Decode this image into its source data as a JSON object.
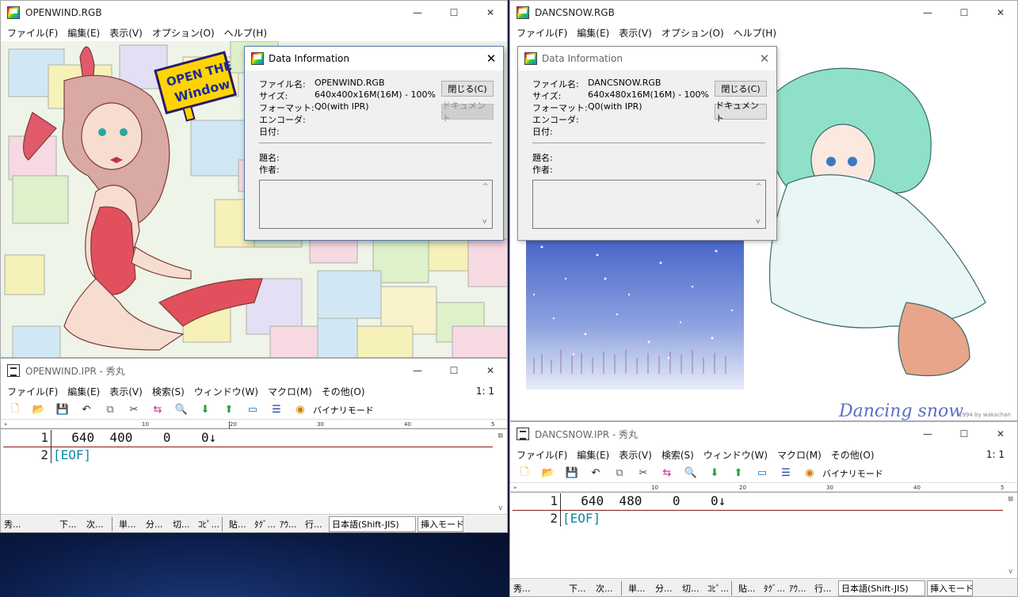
{
  "window_left": {
    "title": "OPENWIND.RGB",
    "menu": [
      "ファイル(F)",
      "編集(E)",
      "表示(V)",
      "オプション(O)",
      "ヘルプ(H)"
    ],
    "image_logo_lines": [
      "OPEN THE",
      "Window"
    ]
  },
  "window_right": {
    "title": "DANCSNOW.RGB",
    "menu": [
      "ファイル(F)",
      "編集(E)",
      "表示(V)",
      "オプション(O)",
      "ヘルプ(H)"
    ],
    "image_caption": "Dancing snow",
    "image_credit": "1994 by wakachan"
  },
  "dialog_left": {
    "title": "Data Information",
    "labels": {
      "filename": "ファイル名:",
      "size": "サイズ:",
      "format": "フォーマット:",
      "encoder": "エンコーダ:",
      "date": "日付:",
      "heading": "題名:",
      "author": "作者:"
    },
    "values": {
      "filename": "OPENWIND.RGB",
      "size": "640x400x16M(16M) - 100%",
      "format": "Q0(with IPR)"
    },
    "close_button": "閉じる(C)",
    "document_button": "ドキュメント"
  },
  "dialog_right": {
    "title": "Data Information",
    "labels": {
      "filename": "ファイル名:",
      "size": "サイズ:",
      "format": "フォーマット:",
      "encoder": "エンコーダ:",
      "date": "日付:",
      "heading": "題名:",
      "author": "作者:"
    },
    "values": {
      "filename": "DANCSNOW.RGB",
      "size": "640x480x16M(16M) - 100%",
      "format": "Q0(with IPR)"
    },
    "close_button": "閉じる(C)",
    "document_button": "ドキュメント"
  },
  "editor_left": {
    "title": "OPENWIND.IPR - 秀丸",
    "menu": [
      "ファイル(F)",
      "編集(E)",
      "表示(V)",
      "検索(S)",
      "ウィンドウ(W)",
      "マクロ(M)",
      "その他(O)"
    ],
    "position": "1: 1",
    "binary_mode_label": "バイナリモード",
    "ruler_marks": [
      "10",
      "20",
      "30",
      "40",
      "5"
    ],
    "lines": [
      {
        "num": "1",
        "text": "  640  400    0    0↓"
      },
      {
        "num": "2",
        "text": "[EOF]"
      }
    ],
    "status": [
      "秀...",
      "下...",
      "次...",
      "単...",
      "分...",
      "切...",
      "ｺﾋﾟ...",
      "貼...",
      "ﾀｸﾞ...",
      "ｱｳ...",
      "行..."
    ],
    "encoding": "日本語(Shift-JIS)",
    "insert_mode": "挿入モード"
  },
  "editor_right": {
    "title": "DANCSNOW.IPR - 秀丸",
    "menu": [
      "ファイル(F)",
      "編集(E)",
      "表示(V)",
      "検索(S)",
      "ウィンドウ(W)",
      "マクロ(M)",
      "その他(O)"
    ],
    "position": "1: 1",
    "binary_mode_label": "バイナリモード",
    "ruler_marks": [
      "10",
      "20",
      "30",
      "40",
      "5"
    ],
    "lines": [
      {
        "num": "1",
        "text": "  640  480    0    0↓"
      },
      {
        "num": "2",
        "text": "[EOF]"
      }
    ],
    "status": [
      "秀...",
      "下...",
      "次...",
      "単...",
      "分...",
      "切...",
      "ｺﾋﾟ...",
      "貼...",
      "ﾀｸﾞ...",
      "ｱｳ...",
      "行..."
    ],
    "encoding": "日本語(Shift-JIS)",
    "insert_mode": "挿入モード"
  },
  "window_controls": {
    "minimize": "—",
    "maximize": "☐",
    "close": "✕"
  },
  "colors": {
    "eof": "#0a8aa8",
    "line_separator": "#8b1a1a",
    "dialog_border": "#5b7ba8"
  }
}
